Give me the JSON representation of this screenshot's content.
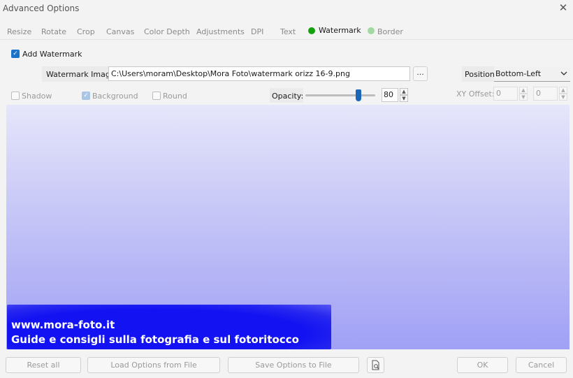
{
  "window": {
    "title": "Advanced Options",
    "close_glyph": "✕"
  },
  "tabs": [
    "Resize",
    "Rotate",
    "Crop",
    "Canvas",
    "Color Depth",
    "Adjustments",
    "DPI",
    "Text",
    "Watermark",
    "Border"
  ],
  "tab_colors": {
    "watermark_dot": "#13a10e",
    "border_dot": "#a4d8a1"
  },
  "watermark": {
    "add_label": "Add Watermark",
    "add_checked": true,
    "image_label": "Watermark Image:",
    "image_path": "C:\\Users\\moram\\Desktop\\Mora Foto\\watermark orizz 16-9.png",
    "browse_label": "...",
    "position_label": "Position:",
    "position_value": "Bottom-Left",
    "shadow_label": "Shadow",
    "background_label": "Background",
    "round_label": "Round",
    "opacity_label": "Opacity:",
    "opacity_value": "80",
    "opacity_fraction": 0.8,
    "xy_label": "XY Offset:",
    "x_offset": "0",
    "y_offset": "0"
  },
  "preview": {
    "line1": "www.mora-foto.it",
    "line2": "Guide e consigli sulla fotografia e sul fotoritocco"
  },
  "footer": {
    "reset": "Reset all",
    "load": "Load Options from File",
    "save": "Save Options to File",
    "ok": "OK",
    "cancel": "Cancel"
  },
  "icons": {
    "close": "close-icon",
    "preview_file": "file-preview-icon",
    "dropdown": "chevron-down-icon"
  }
}
